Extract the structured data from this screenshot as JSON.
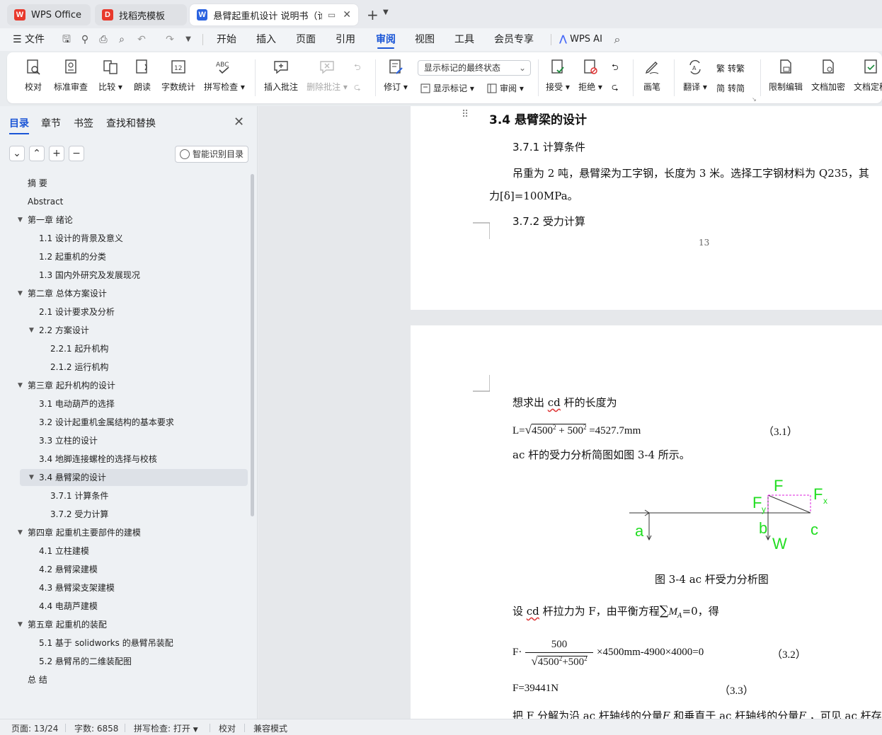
{
  "tabs": {
    "wps": "WPS Office",
    "template": "找稻壳模板",
    "doc": "悬臂起重机设计 说明书（论文"
  },
  "menu": {
    "file": "文件",
    "items": [
      "开始",
      "插入",
      "页面",
      "引用",
      "审阅",
      "视图",
      "工具",
      "会员专享"
    ],
    "active": "审阅",
    "wps_ai": "WPS AI"
  },
  "ribbon": {
    "proofread": "校对",
    "std_review": "标准审查",
    "compare": "比较",
    "read_aloud": "朗读",
    "word_count": "字数统计",
    "spell_check": "拼写检查",
    "insert_comment": "插入批注",
    "delete_comment": "删除批注",
    "revise": "修订",
    "markup_state": "显示标记的最终状态",
    "show_markup": "显示标记",
    "review": "审阅",
    "accept": "接受",
    "reject": "拒绝",
    "pen": "画笔",
    "translate": "翻译",
    "to_trad": "转繁",
    "to_simp": "转简",
    "restrict_edit": "限制编辑",
    "encrypt": "文档加密",
    "finalize": "文档定稿"
  },
  "panel": {
    "tabs": [
      "目录",
      "章节",
      "书签",
      "查找和替换"
    ],
    "smart_toc": "智能识别目录",
    "toc": [
      {
        "text": "摘  要",
        "level": 0,
        "tri": ""
      },
      {
        "text": "Abstract",
        "level": 0,
        "tri": ""
      },
      {
        "text": "第一章  绪论",
        "level": 0,
        "tri": "▼"
      },
      {
        "text": "1.1 设计的背景及意义",
        "level": 1,
        "tri": ""
      },
      {
        "text": "1.2 起重机的分类",
        "level": 1,
        "tri": ""
      },
      {
        "text": "1.3 国内外研究及发展现况",
        "level": 1,
        "tri": ""
      },
      {
        "text": "第二章  总体方案设计",
        "level": 0,
        "tri": "▼"
      },
      {
        "text": "2.1 设计要求及分析",
        "level": 1,
        "tri": ""
      },
      {
        "text": "2.2 方案设计",
        "level": 1,
        "tri": "▼"
      },
      {
        "text": "2.2.1 起升机构",
        "level": 2,
        "tri": ""
      },
      {
        "text": "2.1.2 运行机构",
        "level": 2,
        "tri": ""
      },
      {
        "text": "第三章  起升机构的设计",
        "level": 0,
        "tri": "▼"
      },
      {
        "text": "3.1 电动葫芦的选择",
        "level": 1,
        "tri": ""
      },
      {
        "text": "3.2  设计起重机金属结构的基本要求",
        "level": 1,
        "tri": ""
      },
      {
        "text": "3.3 立柱的设计",
        "level": 1,
        "tri": ""
      },
      {
        "text": "3.4 地脚连接螺栓的选择与校核",
        "level": 1,
        "tri": ""
      },
      {
        "text": "3.4 悬臂梁的设计",
        "level": 1,
        "tri": "▼",
        "selected": true
      },
      {
        "text": "3.7.1 计算条件",
        "level": 2,
        "tri": ""
      },
      {
        "text": "3.7.2 受力计算",
        "level": 2,
        "tri": ""
      },
      {
        "text": "第四章  起重机主要部件的建模",
        "level": 0,
        "tri": "▼"
      },
      {
        "text": "4.1  立柱建模",
        "level": 1,
        "tri": ""
      },
      {
        "text": "4.2  悬臂梁建模",
        "level": 1,
        "tri": ""
      },
      {
        "text": "4.3  悬臂梁支架建模",
        "level": 1,
        "tri": ""
      },
      {
        "text": "4.4  电葫芦建模",
        "level": 1,
        "tri": ""
      },
      {
        "text": "第五章  起重机的装配",
        "level": 0,
        "tri": "▼"
      },
      {
        "text": "5.1  基于 solidworks 的悬臂吊装配",
        "level": 1,
        "tri": ""
      },
      {
        "text": "5.2  悬臂吊的二维装配图",
        "level": 1,
        "tri": ""
      },
      {
        "text": "总  结",
        "level": 0,
        "tri": ""
      }
    ]
  },
  "doc": {
    "page1": {
      "h34": "3.4 悬臂梁的设计",
      "h371": "3.7.1 计算条件",
      "para1a": "吊重为 2 吨，悬臂梁为工字钢，长度为 3 米。选择工字钢材料为 Q235，其",
      "para1b": "力[δ]=100MPa。",
      "h372": "3.7.2 受力计算",
      "page_no": "13"
    },
    "page2": {
      "line1a": "想求出 ",
      "line1b": "cd",
      "line1c": " 杆的长度为",
      "eq1_lhs": "L=",
      "eq1_a": "4500",
      "eq1_b": "500",
      "eq1_rhs": "=4527.7mm",
      "eq1_no": "（3.1）",
      "line2": "ac 杆的受力分析简图如图 3-4 所示。",
      "fig_labels": {
        "F": "F",
        "Fx": "F",
        "Fx_sub": "x",
        "Fy": "F",
        "Fy_sub": "y",
        "a": "a",
        "b": "b",
        "c": "c",
        "W": "W"
      },
      "fig_caption": "图 3-4    ac 杆受力分析图",
      "line3a": "设 ",
      "line3b": "cd",
      "line3c": " 杆拉力为 F，由平衡方程",
      "line3_sum": "∑",
      "line3_M": "M",
      "line3_Msub": "A",
      "line3d": "=0，得",
      "eq2_F": "F·",
      "eq2_num": "500",
      "eq2_den_a": "4500",
      "eq2_den_b": "500",
      "eq2_rhs": "×4500mm-4900×4000=0",
      "eq2_no": "（3.2）",
      "eq3": "F=39441N",
      "eq3_no": "（3.3）",
      "line4a": "把 F 分解为沿 ac 杆轴线的分量",
      "line4_Fx": "F",
      "line4_Fx_sub": "x",
      "line4b": "和垂直于 ac 杆轴线的分量",
      "line4_Fy": "F",
      "line4_Fy_sub": "y",
      "line4c": "，可见 ac 杆存"
    }
  },
  "status": {
    "page": "页面: 13/24",
    "words": "字数: 6858",
    "spell": "拼写检查: 打开",
    "proof": "校对",
    "compat": "兼容模式"
  },
  "colors": {
    "accent": "#1a55d6",
    "fig_green": "#22dd22",
    "fig_magenta": "#dd22dd"
  }
}
